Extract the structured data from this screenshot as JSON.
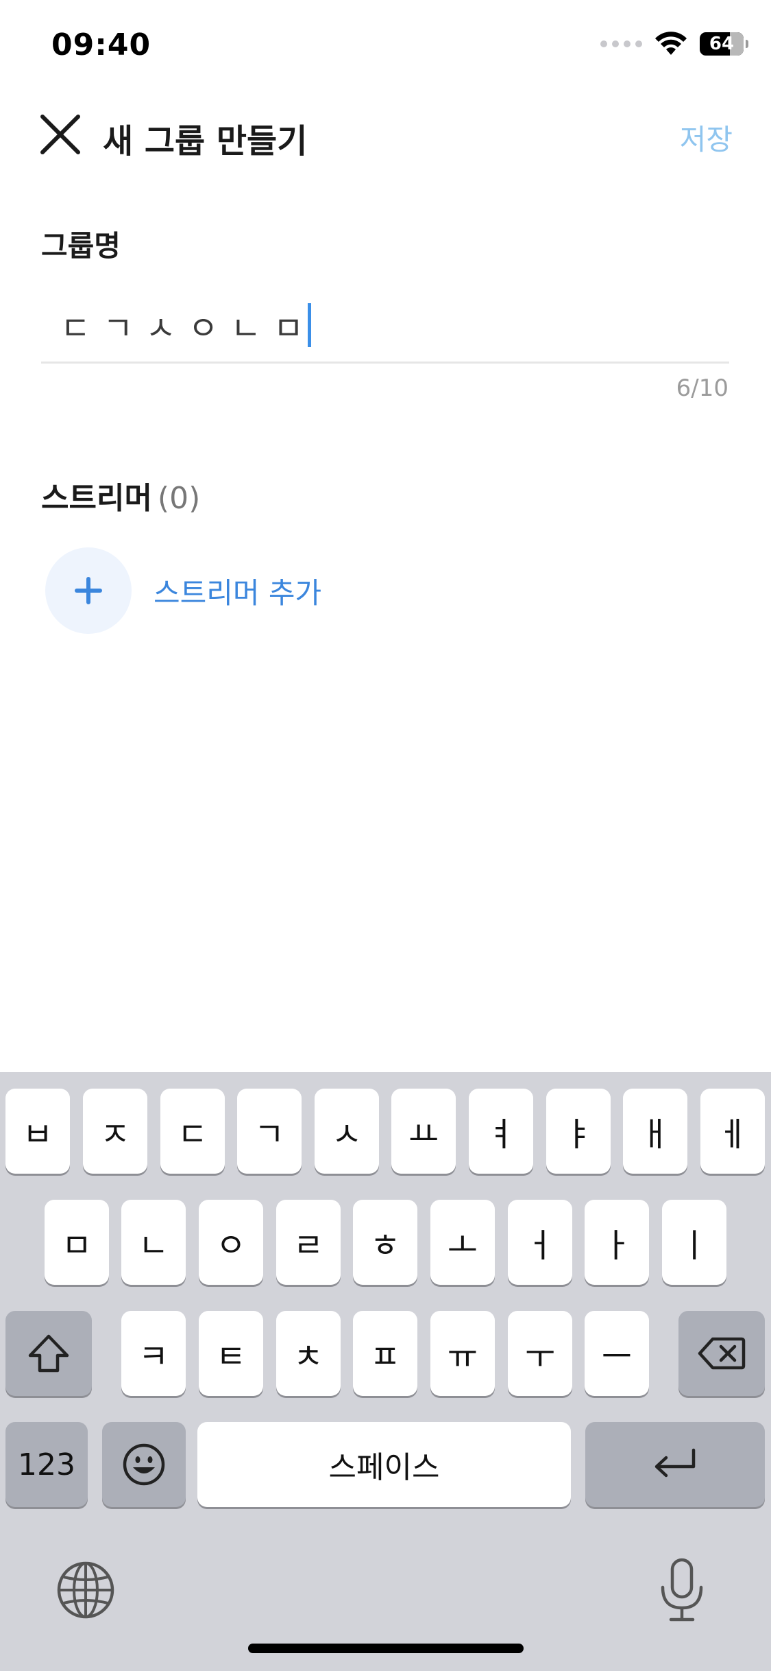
{
  "status": {
    "time": "09:40",
    "battery": "64"
  },
  "header": {
    "title": "새 그룹 만들기",
    "save_label": "저장"
  },
  "group": {
    "label": "그룹명",
    "input_value": "ㄷㄱㅅㅇㄴㅁ",
    "char_count": "6/10"
  },
  "streamer": {
    "label": "스트리머",
    "count": "(0)",
    "add_label": "스트리머 추가"
  },
  "keyboard": {
    "row1": [
      "ㅂ",
      "ㅈ",
      "ㄷ",
      "ㄱ",
      "ㅅ",
      "ㅛ",
      "ㅕ",
      "ㅑ",
      "ㅐ",
      "ㅔ"
    ],
    "row2": [
      "ㅁ",
      "ㄴ",
      "ㅇ",
      "ㄹ",
      "ㅎ",
      "ㅗ",
      "ㅓ",
      "ㅏ",
      "ㅣ"
    ],
    "row3": [
      "ㅋ",
      "ㅌ",
      "ㅊ",
      "ㅍ",
      "ㅠ",
      "ㅜ",
      "ㅡ"
    ],
    "numbers_label": "123",
    "space_label": "스페이스"
  },
  "colors": {
    "accent": "#3b86dd",
    "save_disabled": "#8fc5ef",
    "keyboard_bg": "#d2d3d9"
  }
}
